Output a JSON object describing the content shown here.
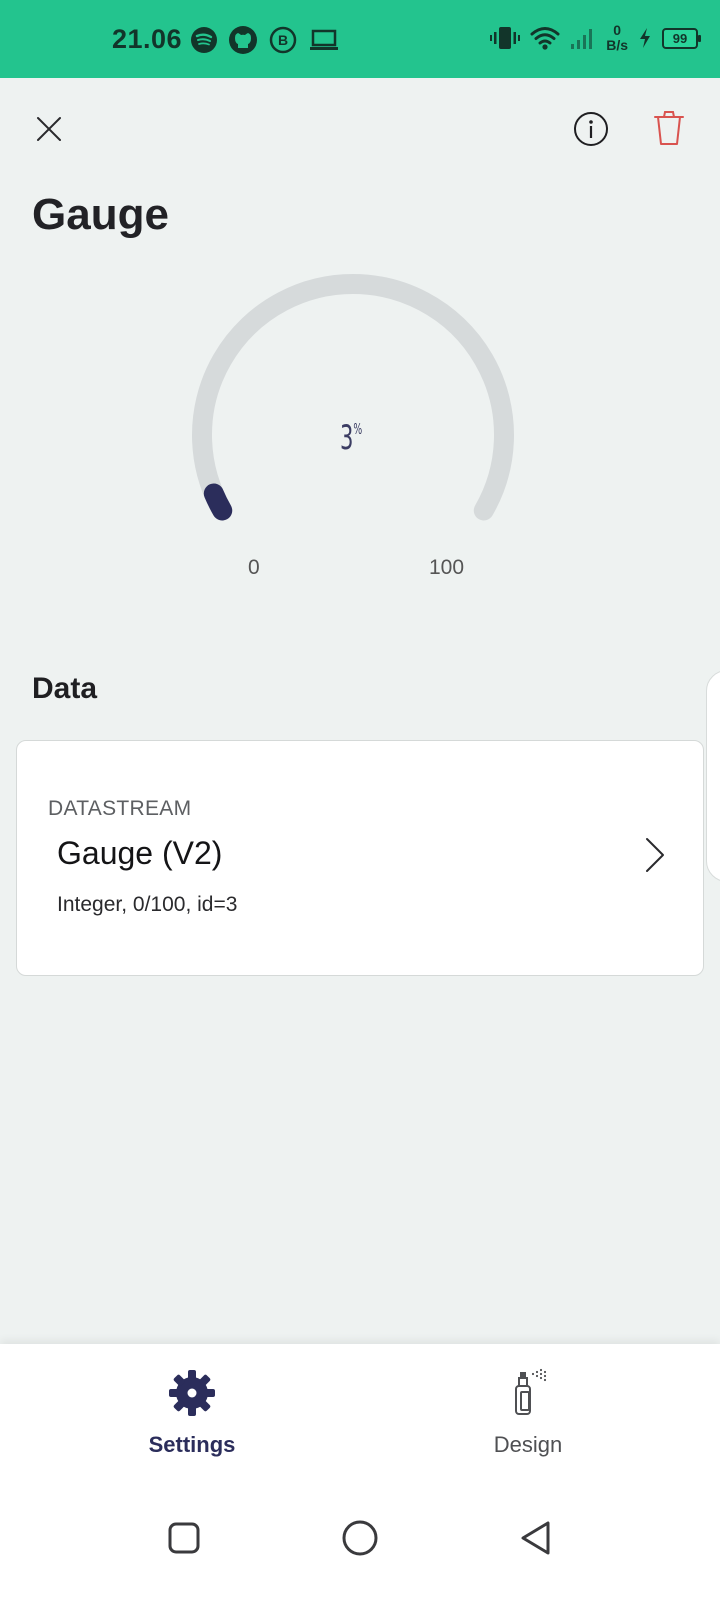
{
  "status_bar": {
    "time": "21.06",
    "left_icons": [
      "spotify-icon",
      "github-icon",
      "whatsapp-business-icon",
      "laptop-icon"
    ],
    "right_icons": [
      "vibrate-icon",
      "wifi-icon",
      "signal-icon",
      "charging-icon"
    ],
    "speed_value": "0",
    "speed_unit": "B/s",
    "battery": "99"
  },
  "header": {
    "title": "Gauge",
    "close_icon": "close-icon",
    "info_icon": "info-icon",
    "delete_icon": "trash-icon"
  },
  "gauge": {
    "value": "3",
    "unit": "%",
    "min": "0",
    "max": "100",
    "fraction": 0.03,
    "track_color": "#d6dadb",
    "fill_color": "#2b2d5b"
  },
  "data_section": {
    "title": "Data",
    "card": {
      "kicker": "DATASTREAM",
      "name": "Gauge (V2)",
      "meta": "Integer, 0/100, id=3"
    }
  },
  "bottom_nav": {
    "settings_label": "Settings",
    "design_label": "Design",
    "active": "Settings"
  },
  "colors": {
    "status_bar": "#23c48e",
    "background": "#eef2f1",
    "accent": "#2b2d5b",
    "delete": "#d9534f"
  }
}
